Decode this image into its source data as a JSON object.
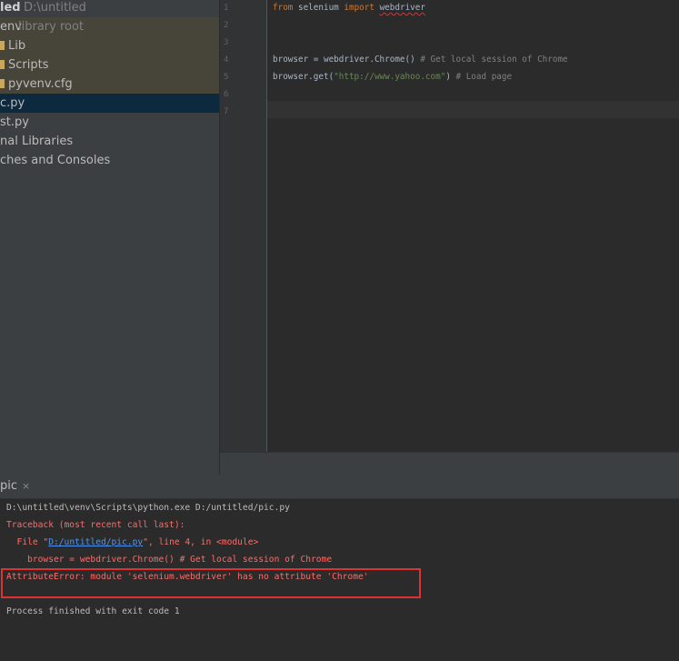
{
  "project": {
    "root_name": "led",
    "root_path": "D:\\untitled",
    "items": [
      {
        "label": "env",
        "hint": "library root"
      },
      {
        "label": "Lib"
      },
      {
        "label": "Scripts"
      },
      {
        "label": "pyvenv.cfg"
      },
      {
        "label": "c.py"
      },
      {
        "label": "st.py"
      },
      {
        "label": "nal Libraries"
      },
      {
        "label": "ches and Consoles"
      }
    ]
  },
  "editor": {
    "line_numbers": [
      "1",
      "2",
      "3",
      "4",
      "5",
      "6",
      "7"
    ],
    "line1": {
      "kw_from": "from",
      "module": " selenium ",
      "kw_import": "import",
      "space": " ",
      "name": "webdriver"
    },
    "line4": {
      "code": "browser = webdriver.Chrome() ",
      "comment": "# Get local session of Chrome"
    },
    "line5": {
      "code_a": "browser.get(",
      "string": "\"http://www.yahoo.com\"",
      "code_b": ") ",
      "comment": "# Load page"
    }
  },
  "run": {
    "tab_label": "pic",
    "close_glyph": "×",
    "console": {
      "line1": "D:\\untitled\\venv\\Scripts\\python.exe D:/untitled/pic.py",
      "line2": "Traceback (most recent call last):",
      "line3_a": "  File \"",
      "line3_link": "D:/untitled/pic.py",
      "line3_b": "\", line 4, in <module>",
      "line4": "    browser = webdriver.Chrome() # Get local session of Chrome",
      "line5": "AttributeError: module 'selenium.webdriver' has no attribute 'Chrome'",
      "line6": "Process finished with exit code 1"
    }
  },
  "colors": {
    "error_text": "#ff6b68",
    "highlight_box": "#e03131",
    "selection": "#0d293e"
  }
}
